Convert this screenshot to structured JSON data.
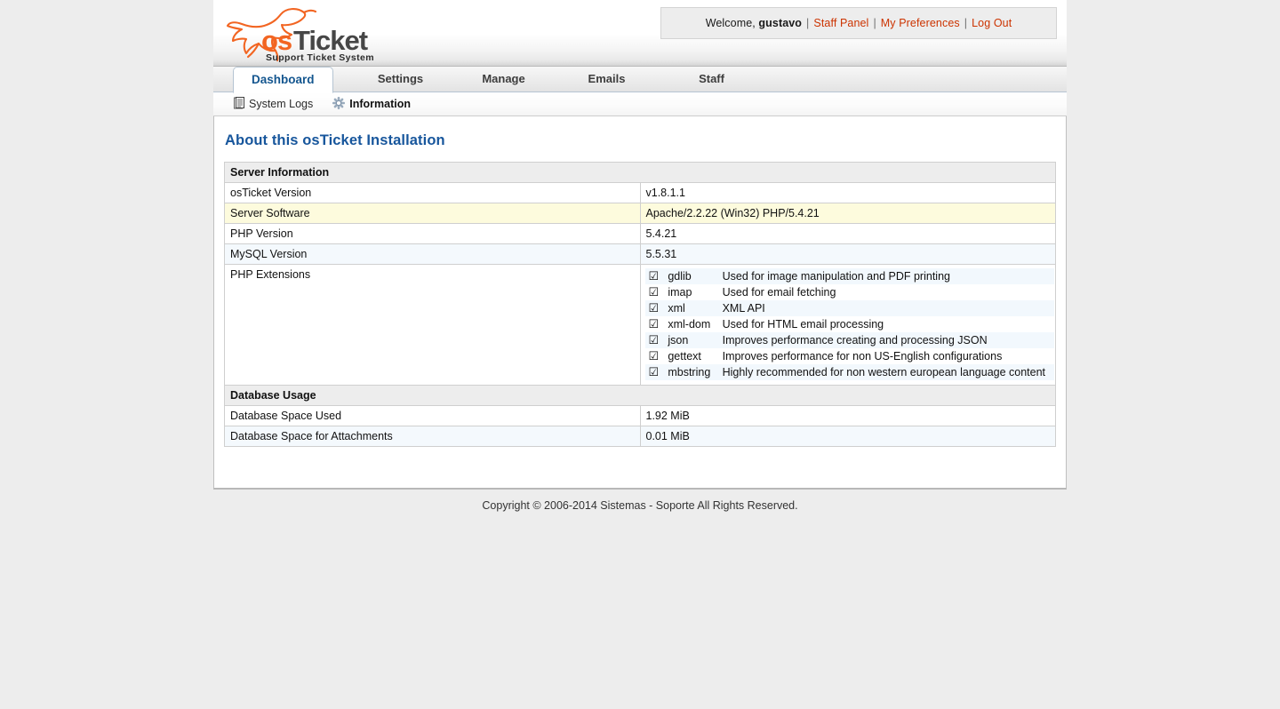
{
  "header": {
    "logo": {
      "brand_os": "os",
      "brand_ticket": "Ticket",
      "tagline": "Support Ticket System"
    },
    "welcome": {
      "greeting": "Welcome,",
      "username": "gustavo",
      "separator": "|",
      "links": [
        {
          "label": "Staff Panel"
        },
        {
          "label": "My Preferences"
        },
        {
          "label": "Log Out"
        }
      ]
    }
  },
  "nav": {
    "tabs": [
      {
        "label": "Dashboard",
        "active": true
      },
      {
        "label": "Settings",
        "active": false
      },
      {
        "label": "Manage",
        "active": false
      },
      {
        "label": "Emails",
        "active": false
      },
      {
        "label": "Staff",
        "active": false
      }
    ],
    "subnav": [
      {
        "label": "System Logs",
        "icon": "document-icon",
        "active": false
      },
      {
        "label": "Information",
        "icon": "gear-icon",
        "active": true
      }
    ]
  },
  "main": {
    "page_title": "About this osTicket Installation",
    "server_section_label": "Server Information",
    "server_rows": [
      {
        "key": "osTicket Version",
        "value": "v1.8.1.1",
        "style": "row-white"
      },
      {
        "key": "Server Software",
        "value": "Apache/2.2.22 (Win32) PHP/5.4.21",
        "style": "row-hl"
      },
      {
        "key": "PHP Version",
        "value": "5.4.21",
        "style": "row-white"
      },
      {
        "key": "MySQL Version",
        "value": "5.5.31",
        "style": "row-alt"
      }
    ],
    "extensions_label": "PHP Extensions",
    "extensions": [
      {
        "checked": "☑",
        "name": "gdlib",
        "description": "Used for image manipulation and PDF printing"
      },
      {
        "checked": "☑",
        "name": "imap",
        "description": "Used for email fetching"
      },
      {
        "checked": "☑",
        "name": "xml",
        "description": "XML API"
      },
      {
        "checked": "☑",
        "name": "xml-dom",
        "description": "Used for HTML email processing"
      },
      {
        "checked": "☑",
        "name": "json",
        "description": "Improves performance creating and processing JSON"
      },
      {
        "checked": "☑",
        "name": "gettext",
        "description": "Improves performance for non US-English configurations"
      },
      {
        "checked": "☑",
        "name": "mbstring",
        "description": "Highly recommended for non western european language content"
      }
    ],
    "database_section_label": "Database Usage",
    "database_rows": [
      {
        "key": "Database Space Used",
        "value": "1.92 MiB",
        "style": "row-white"
      },
      {
        "key": "Database Space for Attachments",
        "value": "0.01 MiB",
        "style": "row-alt"
      }
    ]
  },
  "footer": {
    "copyright": "Copyright © 2006-2014 Sistemas - Soporte All Rights Reserved."
  },
  "colors": {
    "brand_orange": "#f26522",
    "link_orange": "#cc3300",
    "title_blue": "#17569c",
    "highlight_yellow": "#fdfbdd",
    "row_alt_blue": "#f4f9fd"
  }
}
